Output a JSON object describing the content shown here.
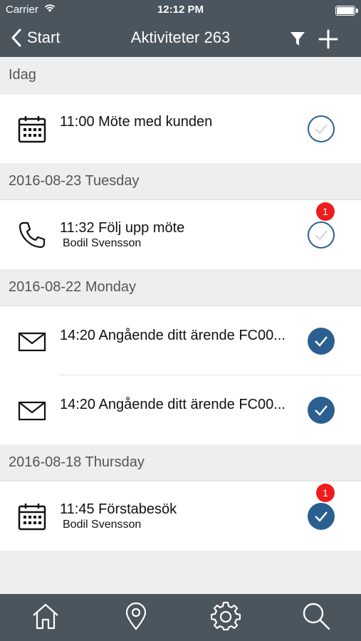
{
  "status_bar": {
    "carrier": "Carrier",
    "time": "12:12 PM"
  },
  "nav": {
    "back_label": "Start",
    "title": "Aktiviteter 263"
  },
  "sections": [
    {
      "header": "Idag",
      "items": [
        {
          "type": "calendar-icon",
          "title": "11:00 Möte med kunden",
          "subtitle": "",
          "done": false,
          "badge": ""
        }
      ]
    },
    {
      "header": "2016-08-23 Tuesday",
      "items": [
        {
          "type": "phone-icon",
          "title": "11:32 Följ upp möte",
          "subtitle": "Bodil Svensson",
          "done": false,
          "badge": "1"
        }
      ]
    },
    {
      "header": "2016-08-22 Monday",
      "items": [
        {
          "type": "mail-icon",
          "title": "14:20 Angående ditt ärende FC00...",
          "subtitle": "",
          "done": true,
          "badge": ""
        },
        {
          "type": "mail-icon",
          "title": "14:20 Angående ditt ärende FC00...",
          "subtitle": "",
          "done": true,
          "badge": ""
        }
      ]
    },
    {
      "header": "2016-08-18 Thursday",
      "items": [
        {
          "type": "calendar-icon",
          "title": "11:45 Förstabesök",
          "subtitle": "Bodil Svensson",
          "done": true,
          "badge": "1"
        }
      ]
    }
  ],
  "tab_bar": [
    "home-icon",
    "location-pin-icon",
    "settings-gear-icon",
    "search-icon"
  ],
  "colors": {
    "bar": "#4a555e",
    "accent": "#2a5f8f",
    "badge": "#ee1c1c",
    "background": "#eeeeee"
  }
}
